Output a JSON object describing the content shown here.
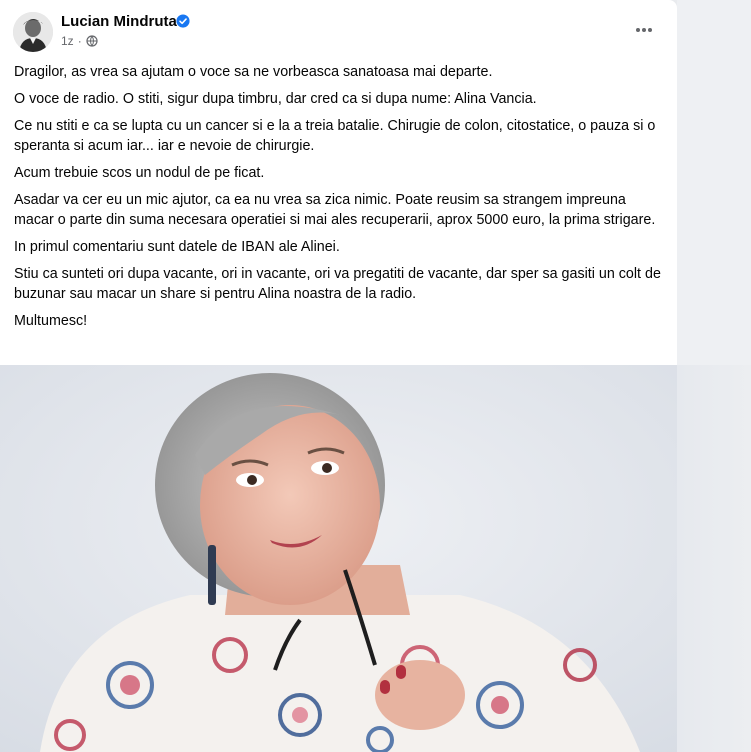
{
  "post": {
    "author": "Lucian Mindruta",
    "time": "1z",
    "separator": "·",
    "paragraphs": [
      "Dragilor, as vrea sa ajutam o voce sa ne vorbeasca sanatoasa mai departe.",
      "O voce de radio. O stiti, sigur dupa timbru, dar cred ca si dupa nume: Alina Vancia.",
      "Ce nu stiti e ca se lupta cu un cancer si e la a treia batalie. Chirugie de colon, citostatice, o pauza si o speranta si acum iar... iar e nevoie de chirurgie.",
      "Acum trebuie scos un nodul de pe ficat.",
      "Asadar va cer eu un mic ajutor, ca ea nu vrea sa zica nimic. Poate reusim sa strangem impreuna macar o parte din suma necesara operatiei si mai ales recuperarii, aprox 5000 euro, la prima strigare.",
      "In primul comentariu sunt datele de IBAN ale Alinei.",
      "Stiu ca sunteti ori dupa vacante, ori in vacante, ori va pregatiti de vacante, dar sper sa gasiti un colt de buzunar sau macar un share si pentru Alina noastra de la radio.",
      "Multumesc!"
    ]
  },
  "icons": {
    "verified": "verified-badge-icon",
    "audience": "globe-icon",
    "more": "more-options-icon"
  },
  "colors": {
    "verified": "#1877f2",
    "meta": "#65676b",
    "background": "#e9ebee"
  }
}
